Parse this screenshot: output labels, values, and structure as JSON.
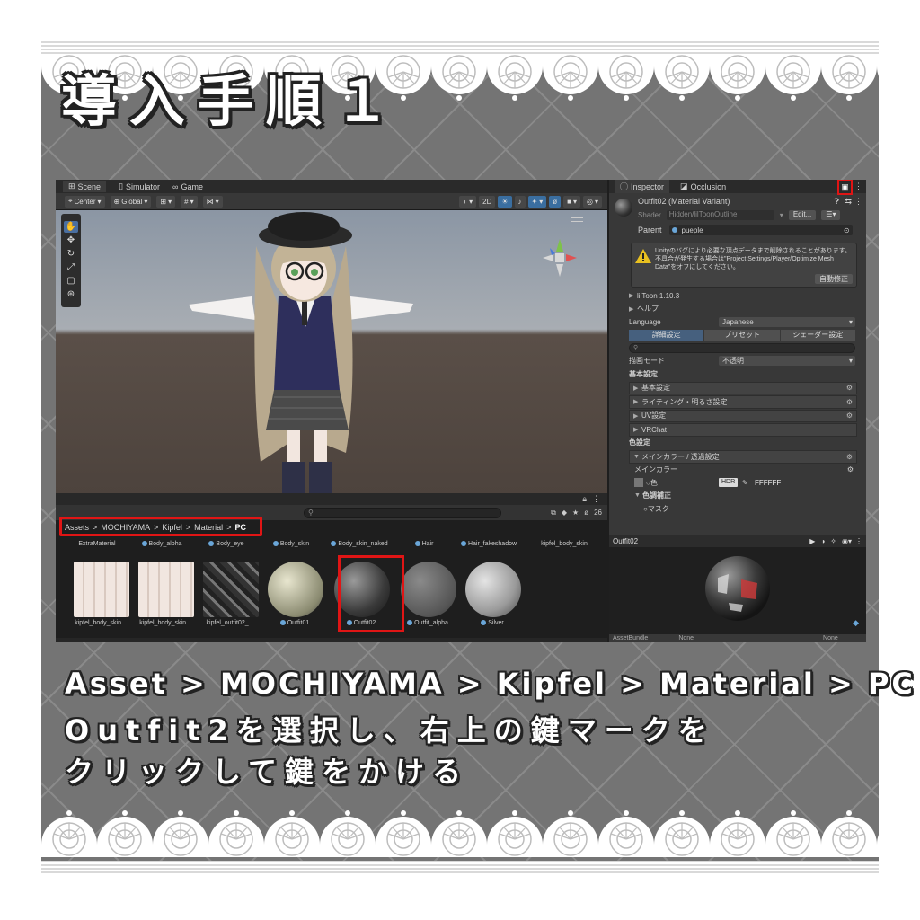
{
  "title": "導入手順１",
  "editor": {
    "scene_tabs": [
      {
        "label": "Scene",
        "icon": "grid-icon"
      },
      {
        "label": "Simulator",
        "icon": "phone-icon"
      },
      {
        "label": "Game",
        "icon": "gamepad-icon"
      }
    ],
    "toolbar": {
      "pivot": "Center",
      "space": "Global",
      "mode_2d": "2D"
    },
    "project": {
      "count": "26",
      "breadcrumb": [
        "Assets",
        "MOCHIYAMA",
        "Kipfel",
        "Material",
        "PC"
      ],
      "row1": [
        "ExtraMaterial",
        "Body_alpha",
        "Body_eye",
        "Body_skin",
        "Body_skin_naked",
        "Hair",
        "Hair_fakeshadow",
        "kipfel_body_skin"
      ],
      "row2": [
        {
          "label": "kipfel_body_skin...",
          "kind": "texture"
        },
        {
          "label": "kipfel_body_skin...",
          "kind": "texture"
        },
        {
          "label": "kipfel_outfit02_...",
          "kind": "texture"
        },
        {
          "label": "Outfit01",
          "kind": "material"
        },
        {
          "label": "Outfit02",
          "kind": "material"
        },
        {
          "label": "Outfit_alpha",
          "kind": "material"
        },
        {
          "label": "Silver",
          "kind": "material"
        }
      ]
    },
    "inspector": {
      "tabs": [
        {
          "label": "Inspector",
          "icon": "info-icon"
        },
        {
          "label": "Occlusion",
          "icon": "occlusion-icon"
        }
      ],
      "material_name": "Outfit02 (Material Variant)",
      "shader_label": "Shader",
      "shader_value": "Hidden/lilToonOutline",
      "edit_label": "Edit...",
      "parent_label": "Parent",
      "parent_value": "pueple",
      "warning_text": "Unityのバグにより必要な頂点データまで削除されることがあります。不具合が発生する場合は\"Project Settings/Player/Optimize Mesh Data\"をオフにしてください。",
      "warning_button": "自動修正",
      "liltoon_version": "lilToon 1.10.3",
      "help": "ヘルプ",
      "language_label": "Language",
      "language_value": "Japanese",
      "mode_tabs": [
        "詳細設定",
        "プリセット",
        "シェーダー設定"
      ],
      "render_mode_label": "描画モード",
      "render_mode_value": "不透明",
      "basic_header": "基本設定",
      "basic_items": [
        "基本設定",
        "ライティング・明るさ設定",
        "UV設定",
        "VRChat"
      ],
      "color_header": "色設定",
      "main_color_fold": "メインカラー / 透過設定",
      "main_color_sub": "メインカラー",
      "color_label": "色",
      "hdr": "HDR",
      "hex": "FFFFFF",
      "color_adjust": "色調補正",
      "mask": "マスク"
    },
    "preview": {
      "title": "Outfit02",
      "assetbundle_label": "AssetBundle",
      "assetbundle_value": "None",
      "variant_value": "None"
    }
  },
  "instructions": [
    "Asset > MOCHIYAMA > Kipfel > Material > PC",
    "Outfit2を選択し、右上の鍵マークを",
    "クリックして鍵をかける"
  ],
  "colors": {
    "highlight": "#e01515",
    "background": "#747474"
  }
}
